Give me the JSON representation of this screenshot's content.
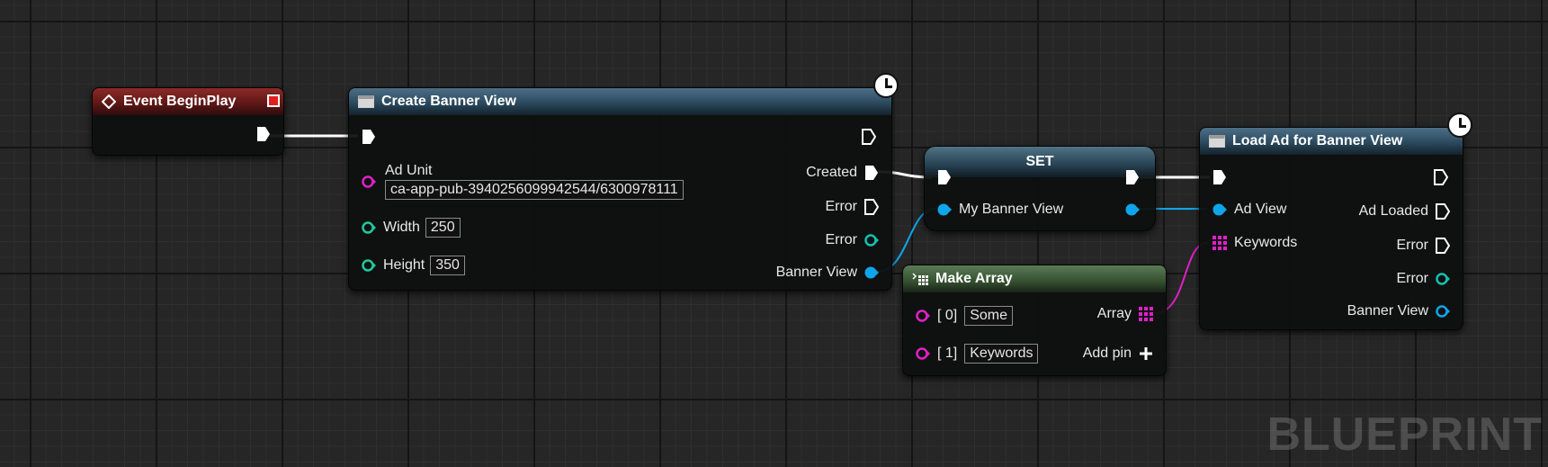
{
  "nodes": {
    "event_begin_play": {
      "title": "Event BeginPlay",
      "color": "#8c2a27"
    },
    "create_banner_view": {
      "title": "Create Banner View",
      "ad_unit_label": "Ad Unit",
      "ad_unit_value": "ca-app-pub-3940256099942544/6300978111",
      "width_label": "Width",
      "width_value": "250",
      "height_label": "Height",
      "height_value": "350",
      "created_label": "Created",
      "error_exec_label": "Error",
      "error_label": "Error",
      "banner_view_label": "Banner View"
    },
    "set": {
      "title": "SET",
      "variable_label": "My Banner View"
    },
    "make_array": {
      "title": "Make Array",
      "item0_label": "[ 0]",
      "item0_value": "Some",
      "item1_label": "[ 1]",
      "item1_value": "Keywords",
      "array_label": "Array",
      "add_pin_label": "Add pin"
    },
    "load_ad": {
      "title": "Load Ad for Banner View",
      "ad_view_label": "Ad View",
      "keywords_label": "Keywords",
      "ad_loaded_label": "Ad Loaded",
      "error_exec_label": "Error",
      "error_label": "Error",
      "banner_view_label": "Banner View"
    }
  },
  "watermark": "BLUEPRINT",
  "colors": {
    "exec": "#ffffff",
    "object_pin": "#0ea5ea",
    "string_pin": "#e020c8",
    "int_pin": "#20c8a0",
    "error_pin": "#16bfb0",
    "array_pin": "#e020c8"
  }
}
